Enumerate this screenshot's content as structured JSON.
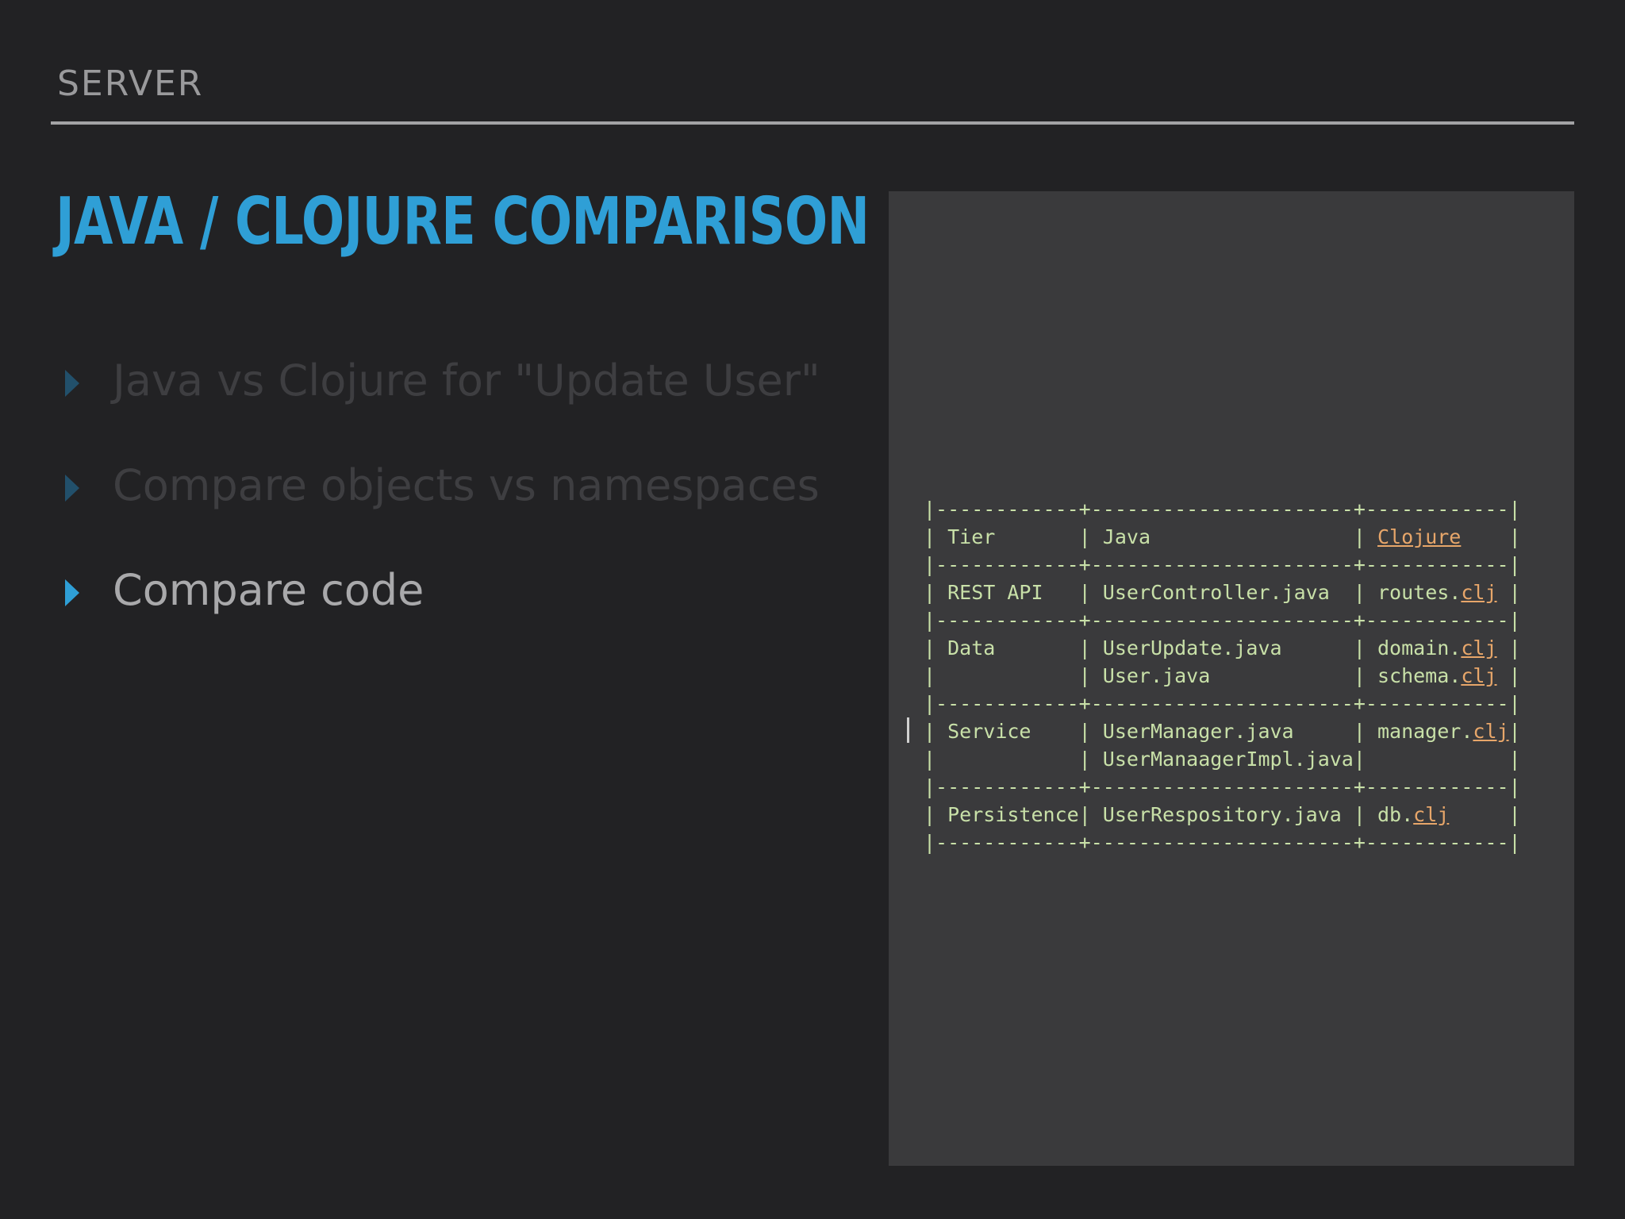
{
  "header": {
    "section": "SERVER"
  },
  "title": "JAVA / CLOJURE COMPARISON",
  "bullets": [
    {
      "text": "Java vs Clojure for \"Update User\"",
      "state": "dim"
    },
    {
      "text": "Compare objects vs namespaces",
      "state": "dim"
    },
    {
      "text": "Compare code",
      "state": "active"
    }
  ],
  "colors": {
    "accent": "#2f9fd6",
    "background": "#222224",
    "panel": "#3a3a3c",
    "code_text": "#c8e0a8",
    "code_highlight": "#e7a66a"
  },
  "code_table": {
    "border": "|------------+----------------------+------------|",
    "rows": [
      {
        "lines": [
          {
            "tier": "Tier",
            "java": "Java",
            "clj_base": "",
            "clj_ext": "Clojure"
          }
        ]
      },
      {
        "lines": [
          {
            "tier": "REST API",
            "java": "UserController.java",
            "clj_base": "routes.",
            "clj_ext": "clj"
          }
        ]
      },
      {
        "lines": [
          {
            "tier": "Data",
            "java": "UserUpdate.java",
            "clj_base": "domain.",
            "clj_ext": "clj"
          },
          {
            "tier": "",
            "java": "User.java",
            "clj_base": "schema.",
            "clj_ext": "clj"
          }
        ]
      },
      {
        "lines": [
          {
            "tier": "Service",
            "java": "UserManager.java",
            "clj_base": "manager.",
            "clj_ext": "clj"
          },
          {
            "tier": "",
            "java": "UserManaagerImpl.java",
            "clj_base": "",
            "clj_ext": ""
          }
        ]
      },
      {
        "lines": [
          {
            "tier": "Persistence",
            "java": "UserRespository.java",
            "clj_base": "db.",
            "clj_ext": "clj"
          }
        ]
      }
    ]
  }
}
